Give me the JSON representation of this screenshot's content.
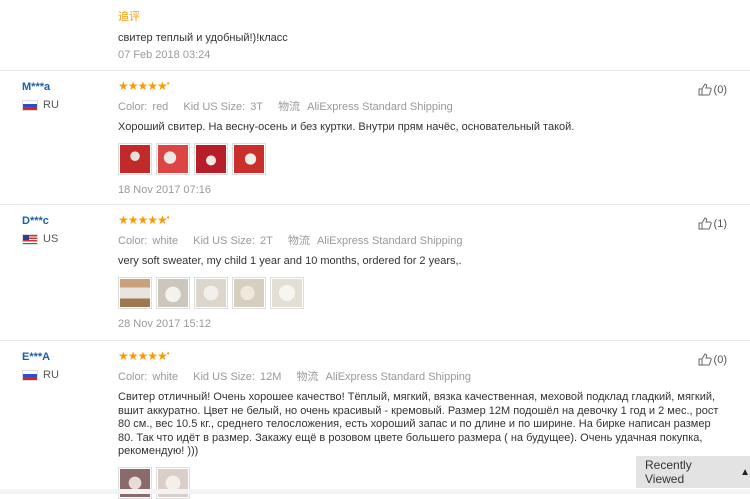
{
  "followup": {
    "label": "追评",
    "text": "свитер теплый и удобный!)!класс",
    "date": "07 Feb 2018 03:24"
  },
  "reviews": [
    {
      "user": "M***a",
      "country": "RU",
      "stars": "★★★★★",
      "color_label": "Color:",
      "color": "red",
      "size_label": "Kid US Size:",
      "size": "3T",
      "ship_label": "物流",
      "shipping": "AliExpress Standard Shipping",
      "text": "Хороший свитер. На весну-осень и без куртки. Внутри прям начёс, основательный такой.",
      "date": "18 Nov 2017 07:16",
      "helpful": "(0)",
      "photos": [
        "#c22a2a",
        "#d44",
        "#b81d2a",
        "#c9302c"
      ]
    },
    {
      "user": "D***c",
      "country": "US",
      "stars": "★★★★★",
      "color_label": "Color:",
      "color": "white",
      "size_label": "Kid US Size:",
      "size": "2T",
      "ship_label": "物流",
      "shipping": "AliExpress Standard Shipping",
      "text": "very soft sweater, my child 1 year and 10 months, ordered for 2 years,.",
      "date": "28 Nov 2017 15:12",
      "helpful": "(1)",
      "photos": [
        "#b08c6a",
        "#d8d4cf",
        "#e6e2dc",
        "#dcd6c8",
        "#ece9e2"
      ]
    },
    {
      "user": "E***A",
      "country": "RU",
      "stars": "★★★★★",
      "color_label": "Color:",
      "color": "white",
      "size_label": "Kid US Size:",
      "size": "12M",
      "ship_label": "物流",
      "shipping": "AliExpress Standard Shipping",
      "text": "Свитер отличный! Очень хорошее качество! Тёплый, мягкий, вязка качественная, меховой подклад гладкий, мягкий, вшит аккуратно. Цвет не белый, но очень красивый - кремовый. Размер 12М подошёл на девочку 1 год и 2 мес., рост 80 см., вес 10.5 кг., среднего телосложения, есть хороший запас и по длине и по ширине. На бирке написан размер 80. Так что идёт в размер. Закажу ещё в розовом цвете большего размера ( на будущее). Очень удачная покупка, рекомендую! )))",
      "date": "",
      "helpful": "(0)",
      "photos": [
        "#8a6a6a",
        "#d9cfc8"
      ]
    }
  ],
  "recently_viewed": "Recently Viewed"
}
